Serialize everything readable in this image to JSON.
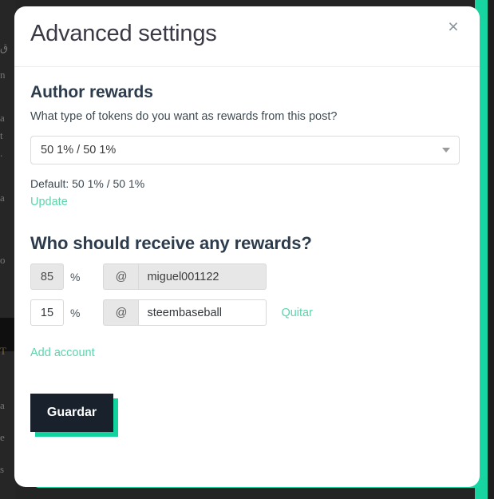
{
  "modal": {
    "title": "Advanced settings",
    "close_icon": "close-icon",
    "close_label": "×"
  },
  "author_rewards": {
    "heading": "Author rewards",
    "description": "What type of tokens do you want as rewards from this post?",
    "select": {
      "value": "50 1% / 50 1%",
      "options": [
        "50 1% / 50 1%"
      ],
      "arrow_icon": "chevron-down-icon"
    },
    "default_text": "Default: 50 1% / 50 1%",
    "update_link": "Update"
  },
  "beneficiaries": {
    "heading": "Who should receive any rewards?",
    "at_symbol": "@",
    "percent_symbol": "%",
    "rows": [
      {
        "percent": "85",
        "account": "miguel001122",
        "remove_label": "",
        "disabled": true
      },
      {
        "percent": "15",
        "account": "steembaseball",
        "remove_label": "Quitar",
        "disabled": false
      }
    ],
    "add_account_link": "Add account"
  },
  "footer": {
    "save_label": "Guardar"
  },
  "colors": {
    "accent_green": "#16d6a3",
    "link_green": "#5ed4ab",
    "save_bg": "#19212c",
    "save_shadow": "#11d39e",
    "title_color": "#3a3a47",
    "heading_color": "#2d3c4c"
  },
  "background": {
    "left_slivers": [
      "ق",
      "n",
      "a",
      "t",
      ".",
      "a",
      "o",
      "T",
      "a",
      "e",
      "s"
    ]
  }
}
